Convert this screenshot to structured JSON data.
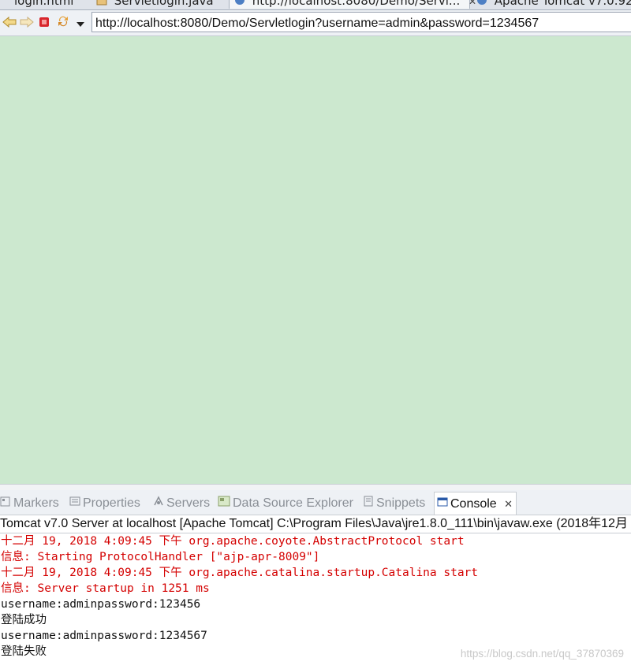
{
  "editor_tabs": [
    {
      "label": "login.html"
    },
    {
      "label": "Servletlogin.java"
    },
    {
      "label": "http://localhost:8080/Demo/Servl..."
    },
    {
      "label": "Apache Tomcat v7.0.92"
    }
  ],
  "toolbar": {
    "url": "http://localhost:8080/Demo/Servletlogin?username=admin&password=1234567"
  },
  "view_tabs": [
    {
      "label": "Markers"
    },
    {
      "label": "Properties"
    },
    {
      "label": "Servers"
    },
    {
      "label": "Data Source Explorer"
    },
    {
      "label": "Snippets"
    },
    {
      "label": "Console"
    }
  ],
  "console": {
    "header": "Tomcat v7.0 Server at localhost [Apache Tomcat] C:\\Program Files\\Java\\jre1.8.0_111\\bin\\javaw.exe (2018年12月",
    "lines": [
      {
        "text": "十二月 19, 2018 4:09:45 下午 org.apache.coyote.AbstractProtocol start",
        "color": "#d40000"
      },
      {
        "text": "信息: Starting ProtocolHandler [\"ajp-apr-8009\"]",
        "color": "#d40000"
      },
      {
        "text": "十二月 19, 2018 4:09:45 下午 org.apache.catalina.startup.Catalina start",
        "color": "#d40000"
      },
      {
        "text": "信息: Server startup in 1251 ms",
        "color": "#d40000"
      },
      {
        "text": "username:adminpassword:123456",
        "color": "#111111"
      },
      {
        "text": "登陆成功",
        "color": "#111111"
      },
      {
        "text": "username:adminpassword:1234567",
        "color": "#111111"
      },
      {
        "text": "登陆失败",
        "color": "#111111"
      }
    ]
  },
  "watermark": "https://blog.csdn.net/qq_37870369",
  "colors": {
    "content_bg": "#cce8cf",
    "console_error": "#d40000"
  }
}
